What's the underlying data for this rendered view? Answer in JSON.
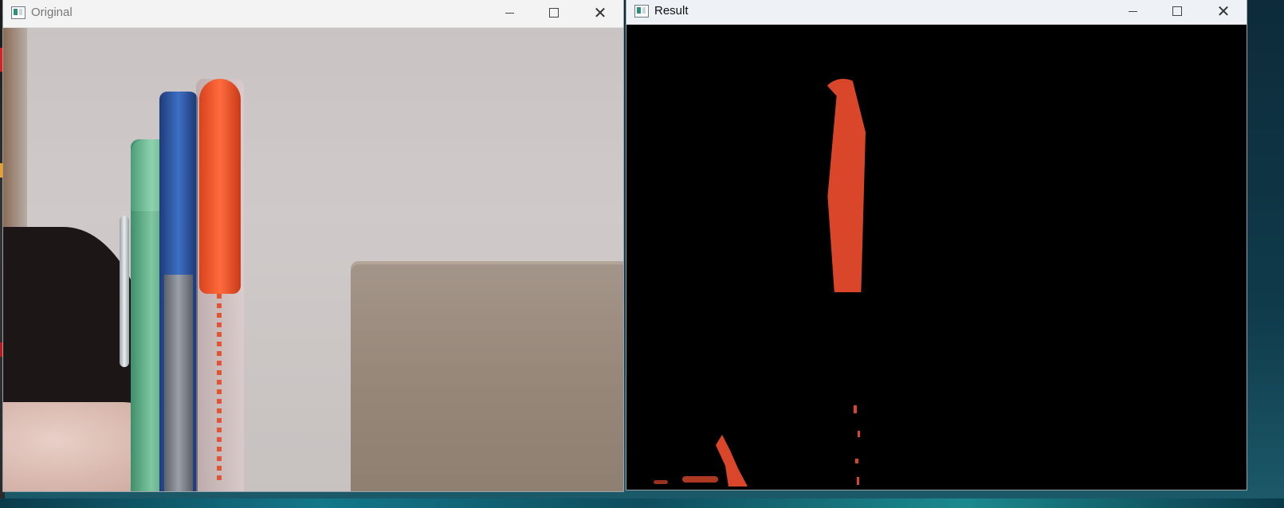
{
  "windows": {
    "original": {
      "title": "Original"
    },
    "result": {
      "title": "Result"
    }
  },
  "titlebar_buttons": {
    "minimize": "─",
    "maximize": "□",
    "close": "✕"
  },
  "colors": {
    "mask_background": "#000000",
    "detected_red": "#d9462a",
    "pen_red": "#ff5a2e",
    "pen_blue": "#2d5ab0",
    "pen_green": "#5fae88"
  }
}
